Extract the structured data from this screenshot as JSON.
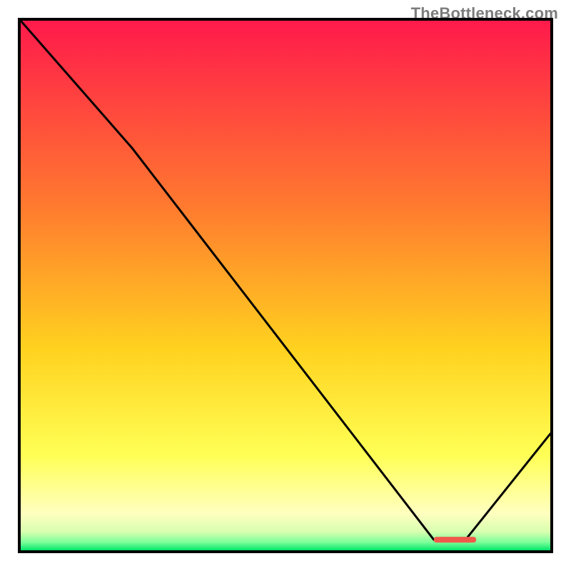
{
  "attribution": "TheBottleneck.com",
  "chart_data": {
    "type": "line",
    "title": "",
    "xlabel": "",
    "ylabel": "",
    "xlim": [
      0,
      100
    ],
    "ylim": [
      0,
      100
    ],
    "x": [
      0,
      21,
      78,
      84,
      100
    ],
    "values": [
      100,
      76,
      2,
      2,
      22
    ],
    "series": [
      {
        "name": "curve",
        "x": [
          0,
          21,
          78,
          84,
          100
        ],
        "values": [
          100,
          76,
          2,
          2,
          22
        ]
      }
    ],
    "highlight_segment": {
      "x_start": 78,
      "x_end": 86,
      "y": 2,
      "color": "#f05a4a"
    },
    "background_gradient": {
      "stops": [
        {
          "offset": 0.0,
          "color": "#ff1a4b"
        },
        {
          "offset": 0.35,
          "color": "#ff7a2f"
        },
        {
          "offset": 0.62,
          "color": "#ffd21f"
        },
        {
          "offset": 0.82,
          "color": "#ffff55"
        },
        {
          "offset": 0.93,
          "color": "#ffffbf"
        },
        {
          "offset": 0.965,
          "color": "#d8ffb0"
        },
        {
          "offset": 0.985,
          "color": "#7bff9a"
        },
        {
          "offset": 1.0,
          "color": "#00e56a"
        }
      ]
    }
  }
}
